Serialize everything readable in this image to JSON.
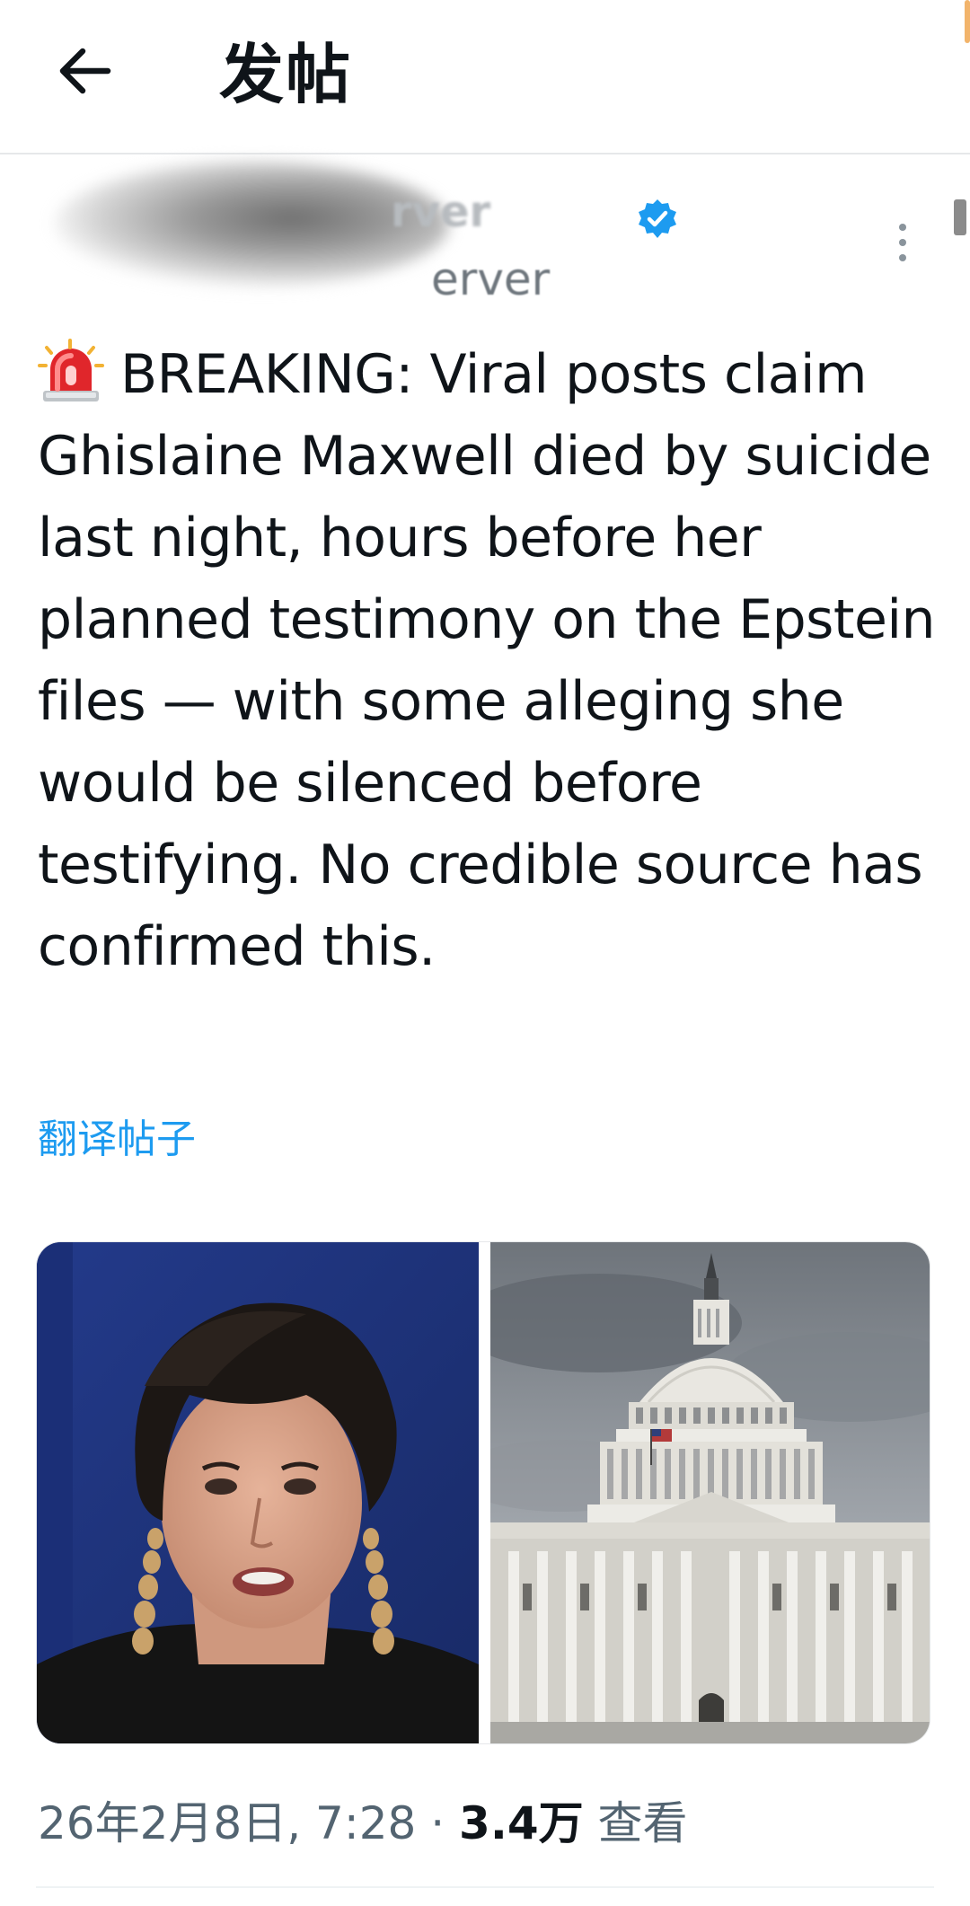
{
  "header": {
    "title": "发帖"
  },
  "author": {
    "name_visible": "rver",
    "handle_visible": "erver",
    "verified": true
  },
  "tweet": {
    "text": "BREAKING: Viral posts claim Ghislaine Maxwell died by suicide last night, hours before her planned testimony on the Epstein files — with some alleging she would be silenced before testifying. No credible source has confirmed this.",
    "lead_icon": "rotating-light-icon"
  },
  "translate_label": "翻译帖子",
  "media": [
    {
      "subject": "woman-portrait"
    },
    {
      "subject": "capitol-building"
    }
  ],
  "meta": {
    "date_time": "26年2月8日, 7:28",
    "separator": "·",
    "views_count": "3.4万",
    "views_label": "查看"
  },
  "colors": {
    "link": "#1d9bf0",
    "verified": "#1d9bf0",
    "secondary_text": "#536471"
  }
}
